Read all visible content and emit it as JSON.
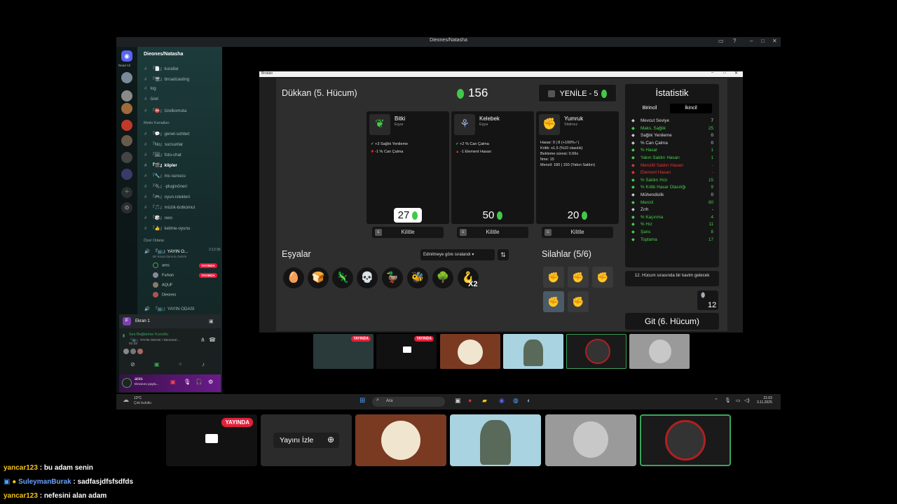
{
  "window": {
    "title": "Dieones/Natasha",
    "minimize": "–",
    "maximize": "□",
    "close": "✕"
  },
  "rail": {
    "read_all": "Read All"
  },
  "server": {
    "name": "Dieones/Natasha",
    "channels": [
      {
        "name": "『📄』kurallar"
      },
      {
        "name": "『🖥』broadcasting"
      },
      {
        "name": "log"
      },
      {
        "name": "özel"
      },
      {
        "name": "『⛔』özelkomuta"
      }
    ],
    "category": "Metin Kanalları",
    "text_channels": [
      {
        "name": "『💬』genel-sohbet"
      },
      {
        "name": "『No』sucsunlar"
      },
      {
        "name": "『🖼』foto-chat"
      },
      {
        "name": "『🎬』klipler"
      },
      {
        "name": "『🔧』mc-sunucu"
      },
      {
        "name": "『🔌』-pluginöneri"
      },
      {
        "name": "『🎮』oyun-istekleri"
      },
      {
        "name": "『🎵』müzik-botkomut"
      },
      {
        "name": "『🎲』owo"
      },
      {
        "name": "『👍』kelime-oyunu"
      }
    ],
    "voice_category": "Özel Odalar",
    "voice_channel": {
      "name": "『📺』YAYIN O...",
      "time": "2:12:36",
      "hint": "Bir kanal durumu belirle",
      "users": [
        {
          "name": "ares",
          "live": "YAYINDA"
        },
        {
          "name": "Furkan",
          "live": "YAYINDA"
        },
        {
          "name": "AQUF",
          "live": ""
        },
        {
          "name": "Dieones",
          "live": ""
        }
      ]
    },
    "voice_channel_2": "『📺』YAYIN ODASI"
  },
  "screen_panel": {
    "title": "Ekran 1",
    "status": "Ses Bağlantısı Kuruldu",
    "channel": "『📺』YAYIN ODASI / Dieones/...",
    "time": "01:32"
  },
  "user_bar": {
    "name": "ares",
    "status": "Ekranını payla..."
  },
  "game": {
    "title": "Brotato",
    "shop_title": "Dükkan (5. Hücum)",
    "money": "156",
    "reroll": "YENİLE - 5",
    "cards": [
      {
        "name": "Bitki",
        "type": "Eşya",
        "icon": "sprout-icon",
        "lines": [
          "+3 Sağlık Yenileme",
          "-1 % Can Çalma"
        ],
        "price": "27",
        "selected": true
      },
      {
        "name": "Kelebek",
        "type": "Eşya",
        "icon": "butterfly-icon",
        "lines": [
          "+2 % Can Çalma",
          "-1 Element Hasarı"
        ],
        "price": "50",
        "selected": false
      },
      {
        "name": "Yumruk",
        "type": "Silahsız",
        "icon": "fist-icon",
        "lines": [
          "Hasar: 9 | 8 (+100%✓)",
          "Kritik: x1.5 (%10 olasılık)",
          "Bekleme süresi: 0.69s",
          "İtme: 15",
          "Menzil: 180 | 150 (Yakın Saldırı)"
        ],
        "price": "20",
        "selected": false
      }
    ],
    "lock_label": "Kilitle",
    "lock_key": "E",
    "items_title": "Eşyalar",
    "sort_label": "Edinilmeye göre sıralandı",
    "items": [
      "🥚",
      "🍞",
      "🦎",
      "💀",
      "🦆",
      "🐝",
      "🌳",
      "🪝"
    ],
    "items_last_count": "X2",
    "weapons_title": "Silahlar (5/6)",
    "weapons_count": 5,
    "wave_notice": "12. Hücum sırasında bir kavim gelecek",
    "material_count": "12",
    "go_button": "Git (6. Hücum)",
    "stats_title": "İstatistik",
    "stats_tabs": [
      "Birincil",
      "İkincil"
    ],
    "stats": [
      {
        "label": "Mevcut Seviye",
        "value": "7",
        "color": "w"
      },
      {
        "label": "Maks. Sağlık",
        "value": "25",
        "color": "g"
      },
      {
        "label": "Sağlık Yenileme",
        "value": "0",
        "color": "w"
      },
      {
        "label": "% Can Çalma",
        "value": "0",
        "color": "w"
      },
      {
        "label": "% Hasar",
        "value": "1",
        "color": "g"
      },
      {
        "label": "Yakın Saldırı Hasarı",
        "value": "1",
        "color": "g"
      },
      {
        "label": "Menzilli Saldırı Hasarı",
        "value": "-",
        "color": "r"
      },
      {
        "label": "Element Hasarı",
        "value": "-",
        "color": "r"
      },
      {
        "label": "% Saldırı Hızı",
        "value": "15",
        "color": "g"
      },
      {
        "label": "% Kritik Hasar Olasılığı",
        "value": "9",
        "color": "g"
      },
      {
        "label": "Mühendislik",
        "value": "0",
        "color": "w"
      },
      {
        "label": "Menzil",
        "value": "80",
        "color": "g"
      },
      {
        "label": "Zırh",
        "value": "-",
        "color": "w"
      },
      {
        "label": "% Kaçınma",
        "value": "4",
        "color": "g"
      },
      {
        "label": "% Hız",
        "value": "11",
        "color": "g"
      },
      {
        "label": "Şans",
        "value": "8",
        "color": "g"
      },
      {
        "label": "Toplama",
        "value": "17",
        "color": "g"
      }
    ]
  },
  "thumbs": {
    "live_label": "YAYINDA"
  },
  "tiles": {
    "live_label": "YAYINDA",
    "watch_label": "Yayını İzle"
  },
  "taskbar": {
    "weather_temp": "13°C",
    "weather_desc": "Çok bulutlu",
    "search": "Ara",
    "time": "21:03",
    "date": "3.11.2025"
  },
  "chat": [
    {
      "user": "yancar123",
      "message": "bu adam senin"
    },
    {
      "user": "SuleymanBurak",
      "message": "sadfasjdfsfsdfds"
    },
    {
      "user": "yancar123",
      "message": "nefesini alan adam"
    }
  ],
  "colors": {
    "accent_green": "#44d24b",
    "live_red": "#e3203a",
    "discord_teal": "#1c3b3a"
  }
}
